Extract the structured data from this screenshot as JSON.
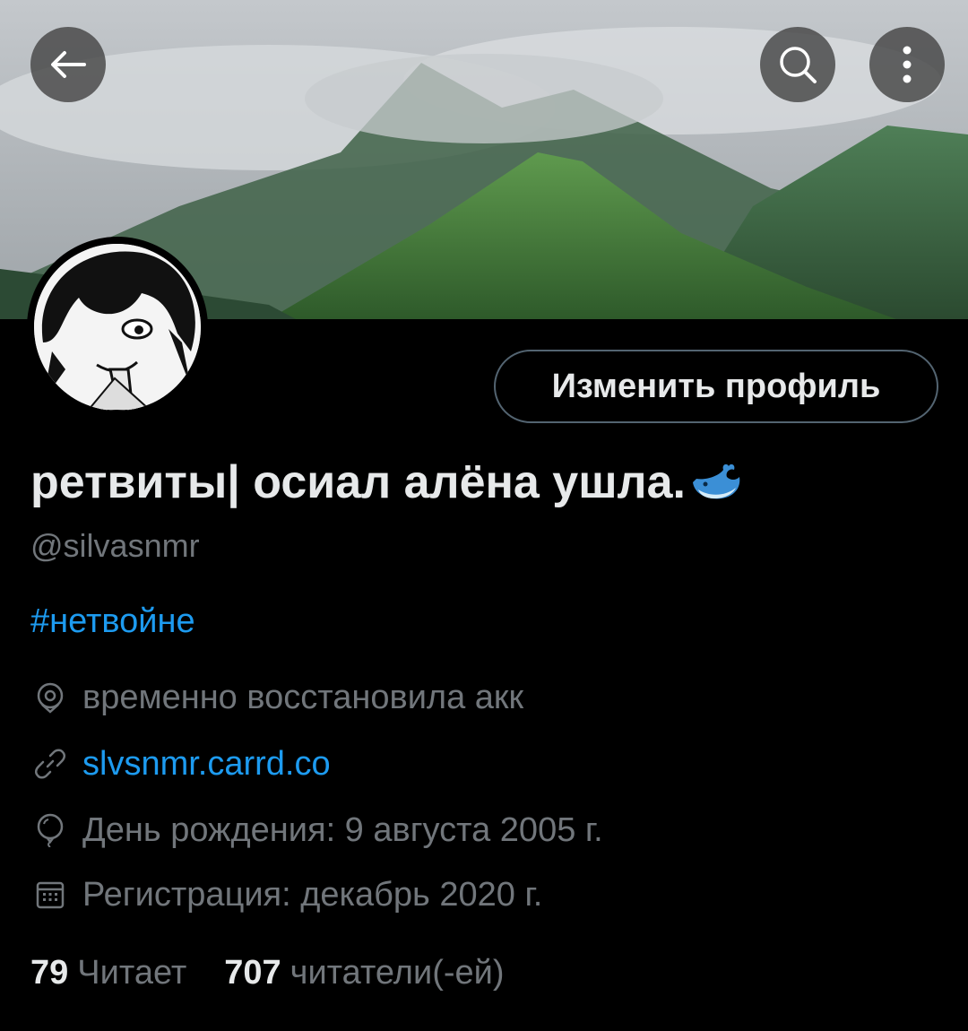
{
  "profile": {
    "display_name": "ретвиты| осиал алёна ушла.",
    "name_emoji": "whale-emoji",
    "handle": "@silvasnmr",
    "bio": "#нетвойне",
    "location": "временно восстановила акк",
    "website": "slvsnmr.carrd.co",
    "birthday": "День рождения: 9 августа 2005 г.",
    "joined": "Регистрация: декабрь 2020 г."
  },
  "stats": {
    "following_count": "79",
    "following_label": "Читает",
    "followers_count": "707",
    "followers_label": "читатели(-ей)"
  },
  "actions": {
    "edit_profile_label": "Изменить профиль"
  },
  "colors": {
    "background": "#000000",
    "accent": "#1d9bf0",
    "secondary_text": "#71767b",
    "primary_text": "#e7e9ea"
  }
}
